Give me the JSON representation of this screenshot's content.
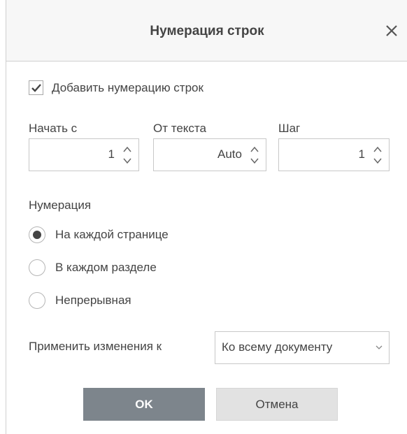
{
  "dialog": {
    "title": "Нумерация строк",
    "close_icon": "close-icon"
  },
  "add_numbering": {
    "label": "Добавить нумерацию строк",
    "checked": true
  },
  "fields": {
    "start": {
      "label": "Начать с",
      "value": "1"
    },
    "from_text": {
      "label": "От текста",
      "value": "Auto"
    },
    "step": {
      "label": "Шаг",
      "value": "1"
    }
  },
  "numbering": {
    "label": "Нумерация",
    "options": [
      {
        "label": "На каждой странице",
        "selected": true
      },
      {
        "label": "В каждом разделе",
        "selected": false
      },
      {
        "label": "Непрерывная",
        "selected": false
      }
    ]
  },
  "apply": {
    "label": "Применить изменения к",
    "value": "Ко всему документу"
  },
  "buttons": {
    "ok": "OK",
    "cancel": "Отмена"
  },
  "colors": {
    "ok_bg": "#7d858c",
    "cancel_bg": "#e2e2e2",
    "header_bg": "#f7f7f7",
    "text": "#444444"
  }
}
